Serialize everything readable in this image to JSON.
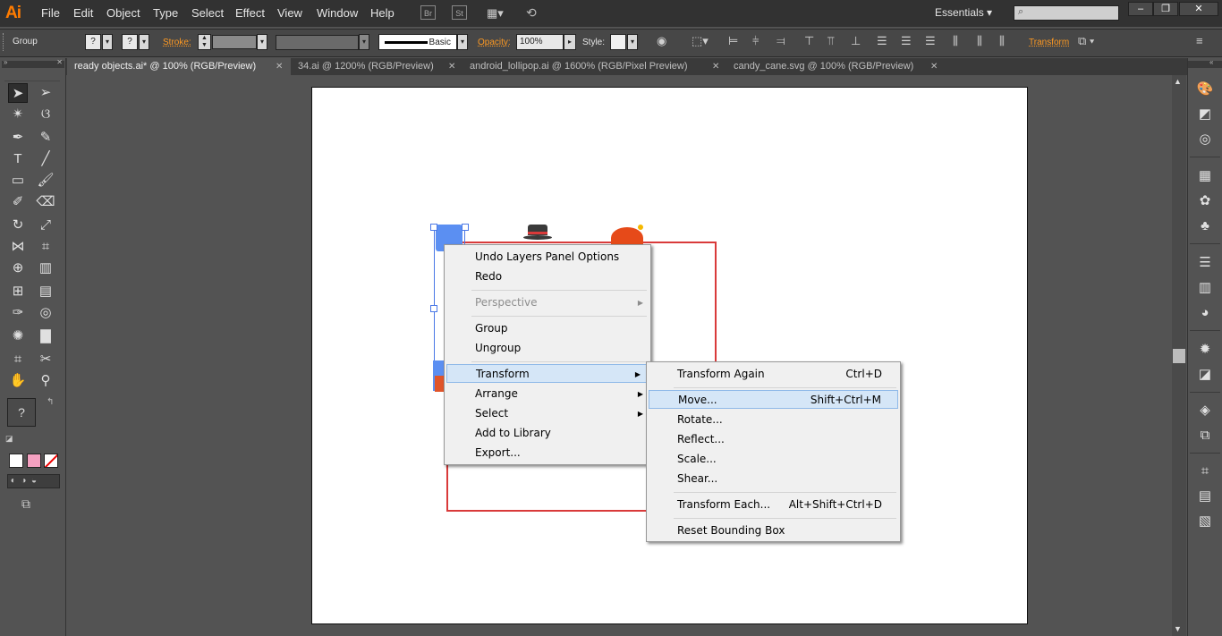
{
  "app": {
    "logo": "Ai"
  },
  "menubar": {
    "items": [
      "File",
      "Edit",
      "Object",
      "Type",
      "Select",
      "Effect",
      "View",
      "Window",
      "Help"
    ],
    "bridge": "Br",
    "stock": "St",
    "workspace": "Essentials"
  },
  "control": {
    "selection_label": "Group",
    "fill_q": "?",
    "stroke_q": "?",
    "stroke_label": "Stroke:",
    "brush_label": "Basic",
    "opacity_label": "Opacity:",
    "opacity_value": "100%",
    "style_label": "Style:",
    "transform_label": "Transform"
  },
  "tabs": [
    {
      "label": "ready objects.ai* @ 100% (RGB/Preview)",
      "active": true
    },
    {
      "label": "34.ai @ 1200% (RGB/Preview)",
      "active": false
    },
    {
      "label": "android_lollipop.ai @ 1600% (RGB/Pixel Preview)",
      "active": false
    },
    {
      "label": "candy_cane.svg @ 100% (RGB/Preview)",
      "active": false
    }
  ],
  "toolbar": {
    "fill_q": "?",
    "stroke_q": "?"
  },
  "context_menu": {
    "items": [
      {
        "label": "Undo Layers Panel Options"
      },
      {
        "label": "Redo"
      },
      {
        "label": "Perspective",
        "disabled": true,
        "submenu": true
      },
      {
        "label": "Group"
      },
      {
        "label": "Ungroup"
      },
      {
        "label": "Transform",
        "submenu": true,
        "highlighted": true
      },
      {
        "label": "Arrange",
        "submenu": true
      },
      {
        "label": "Select",
        "submenu": true
      },
      {
        "label": "Add to Library"
      },
      {
        "label": "Export..."
      }
    ]
  },
  "transform_submenu": {
    "items": [
      {
        "label": "Transform Again",
        "shortcut": "Ctrl+D"
      },
      {
        "label": "Move...",
        "shortcut": "Shift+Ctrl+M",
        "highlighted": true
      },
      {
        "label": "Rotate...",
        "shortcut": ""
      },
      {
        "label": "Reflect...",
        "shortcut": ""
      },
      {
        "label": "Scale...",
        "shortcut": ""
      },
      {
        "label": "Shear...",
        "shortcut": ""
      },
      {
        "label": "Transform Each...",
        "shortcut": "Alt+Shift+Ctrl+D"
      },
      {
        "label": "Reset Bounding Box",
        "shortcut": ""
      }
    ]
  },
  "colors": {
    "accent": "#ff9a22",
    "highlight": "#d5e6f7",
    "artboard_rect": "#d93a3a",
    "selection": "#4a78e6"
  }
}
